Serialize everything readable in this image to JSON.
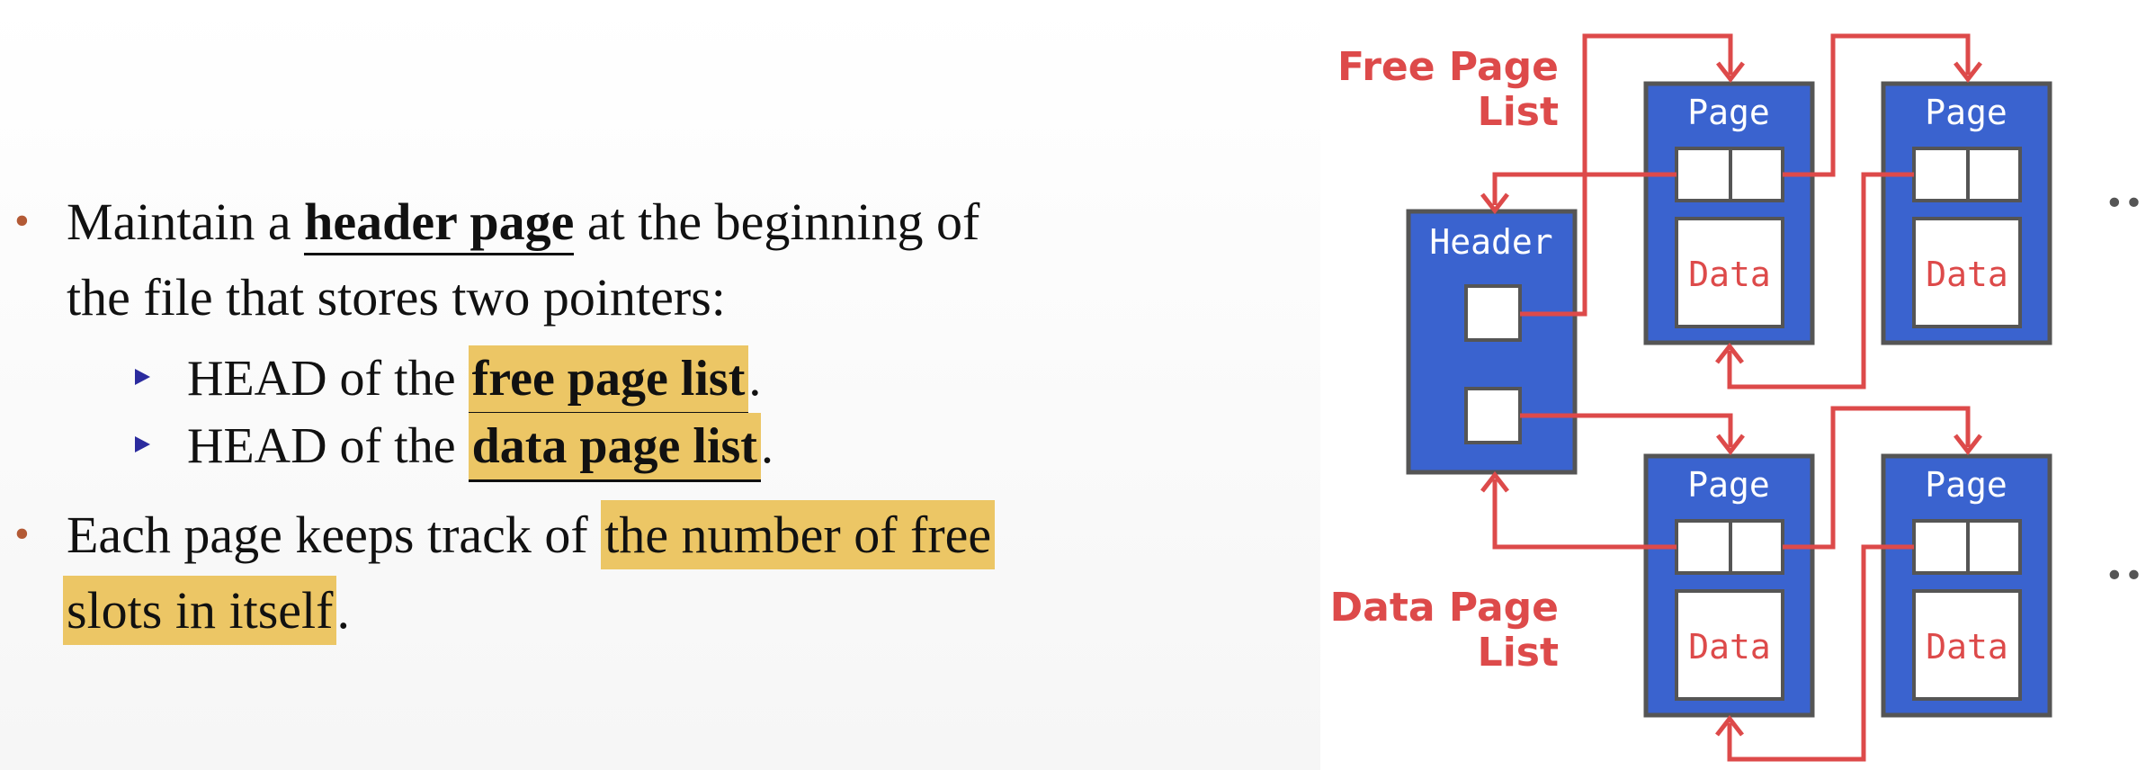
{
  "bullets": {
    "b1_part1": "Maintain a ",
    "b1_bold": "header page",
    "b1_part2": " at the beginning of",
    "b1_line2": "the file that stores two pointers:",
    "s1_prefix": "HEAD of the ",
    "s1_hl": "free page list",
    "s1_suffix": ".",
    "s2_prefix": "HEAD of the ",
    "s2_hl": "data page list",
    "s2_suffix": ".",
    "b2_part1": "Each page keeps track of ",
    "b2_hl1": "the number of free",
    "b2_hl2": "slots in itself",
    "b2_suffix": "."
  },
  "diagram": {
    "free_list_label_1": "Free Page",
    "free_list_label_2": "List",
    "data_list_label_1": "Data Page",
    "data_list_label_2": "List",
    "header_label": "Header",
    "page_label": "Page",
    "data_label": "Data",
    "ellipsis": "•••"
  },
  "colors": {
    "page_blue": "#3a63cf",
    "border_gray": "#555555",
    "arrow_red": "#dd4a4a",
    "highlight": "#ecc665",
    "bullet": "#b35a35"
  }
}
